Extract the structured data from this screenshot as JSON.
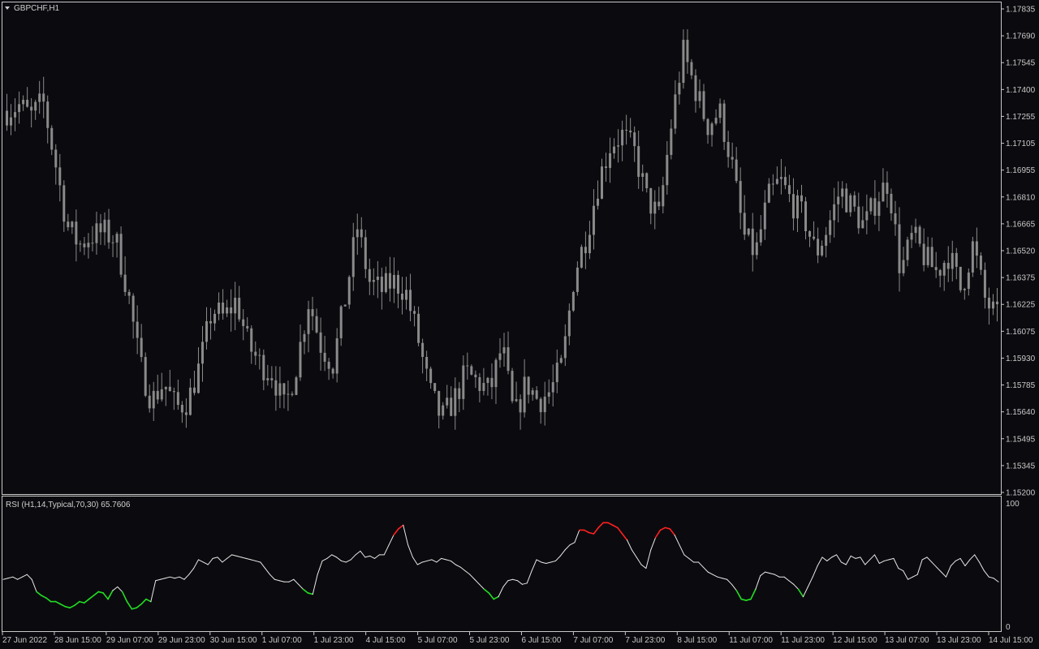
{
  "window": {
    "symbol_title": "GBPCHF,H1"
  },
  "colors": {
    "background": "#0b0b0f",
    "frame": "#c8c8c8",
    "candle": "#8a8a8a",
    "rsi_line": "#e8e8e8",
    "rsi_overbought": "#ff2020",
    "rsi_oversold": "#22dd22",
    "text": "#c8c8c8"
  },
  "chart_data": [
    {
      "type": "candlestick",
      "title": "GBPCHF,H1",
      "ylim": [
        1.152,
        1.17835
      ],
      "price_axis_labels": [
        "1.17835",
        "1.17690",
        "1.17545",
        "1.17400",
        "1.17255",
        "1.17105",
        "1.16955",
        "1.16810",
        "1.16665",
        "1.16520",
        "1.16375",
        "1.16225",
        "1.16075",
        "1.15930",
        "1.15785",
        "1.15640",
        "1.15495",
        "1.15345",
        "1.15200"
      ],
      "time_axis_labels": [
        "27 Jun 2022",
        "28 Jun 15:00",
        "29 Jun 07:00",
        "29 Jun 23:00",
        "30 Jun 15:00",
        "1 Jul 07:00",
        "1 Jul 23:00",
        "4 Jul 15:00",
        "5 Jul 07:00",
        "5 Jul 23:00",
        "6 Jul 15:00",
        "7 Jul 07:00",
        "7 Jul 23:00",
        "8 Jul 15:00",
        "11 Jul 07:00",
        "11 Jul 23:00",
        "12 Jul 15:00",
        "13 Jul 07:00",
        "13 Jul 23:00",
        "14 Jul 15:00"
      ],
      "close_path": [
        1.1728,
        1.1731,
        1.1725,
        1.1733,
        1.17,
        1.1665,
        1.1655,
        1.166,
        1.1662,
        1.1658,
        1.163,
        1.159,
        1.157,
        1.158,
        1.1566,
        1.157,
        1.159,
        1.162,
        1.1615,
        1.1625,
        1.16,
        1.159,
        1.1585,
        1.1565,
        1.159,
        1.1625,
        1.16,
        1.159,
        1.1625,
        1.1665,
        1.1635,
        1.163,
        1.1635,
        1.163,
        1.1605,
        1.1575,
        1.156,
        1.157,
        1.1585,
        1.158,
        1.1575,
        1.16,
        1.156,
        1.158,
        1.157,
        1.1575,
        1.159,
        1.164,
        1.166,
        1.169,
        1.171,
        1.1715,
        1.1705,
        1.168,
        1.167,
        1.172,
        1.176,
        1.174,
        1.172,
        1.1728,
        1.17,
        1.166,
        1.165,
        1.168,
        1.169,
        1.1678,
        1.167,
        1.165,
        1.1665,
        1.1685,
        1.1675,
        1.1665,
        1.168,
        1.169,
        1.164,
        1.166,
        1.1648,
        1.164,
        1.165,
        1.163,
        1.1655,
        1.1625,
        1.1615
      ],
      "rsi_indicator": {
        "label": "RSI (H1,14,Typical,70,30) 65.7606",
        "levels": [
          30,
          70
        ],
        "ylim": [
          0,
          100
        ],
        "scale_labels": [
          "100",
          "0"
        ],
        "values": [
          38,
          39,
          40,
          38,
          40,
          42,
          38,
          28,
          25,
          23,
          20,
          20,
          18,
          16,
          15,
          17,
          20,
          19,
          22,
          25,
          28,
          27,
          22,
          29,
          32,
          28,
          20,
          14,
          15,
          18,
          22,
          20,
          37,
          38,
          39,
          40,
          39,
          40,
          38,
          42,
          47,
          54,
          52,
          50,
          55,
          56,
          52,
          55,
          58,
          57,
          56,
          55,
          54,
          53,
          52,
          47,
          42,
          38,
          37,
          36,
          36,
          38,
          34,
          30,
          27,
          26,
          42,
          53,
          55,
          58,
          56,
          53,
          52,
          54,
          58,
          61,
          56,
          57,
          55,
          58,
          58,
          66,
          74,
          79,
          82,
          66,
          56,
          50,
          52,
          53,
          54,
          52,
          55,
          54,
          53,
          50,
          48,
          45,
          42,
          38,
          34,
          30,
          27,
          22,
          24,
          32,
          37,
          38,
          37,
          34,
          35,
          45,
          54,
          52,
          51,
          52,
          53,
          57,
          62,
          66,
          68,
          78,
          78,
          76,
          75,
          80,
          84,
          84,
          82,
          80,
          75,
          70,
          62,
          56,
          50,
          47,
          62,
          72,
          78,
          80,
          79,
          74,
          66,
          58,
          55,
          52,
          52,
          48,
          44,
          42,
          40,
          39,
          38,
          34,
          29,
          22,
          21,
          22,
          30,
          41,
          44,
          43,
          42,
          40,
          40,
          37,
          34,
          30,
          24,
          32,
          40,
          49,
          56,
          53,
          56,
          58,
          52,
          50,
          57,
          55,
          56,
          50,
          54,
          58,
          51,
          53,
          54,
          55,
          47,
          45,
          38,
          40,
          42,
          54,
          56,
          52,
          48,
          44,
          40,
          49,
          53,
          55,
          49,
          54,
          58,
          52,
          45,
          40,
          39,
          36
        ]
      }
    }
  ]
}
